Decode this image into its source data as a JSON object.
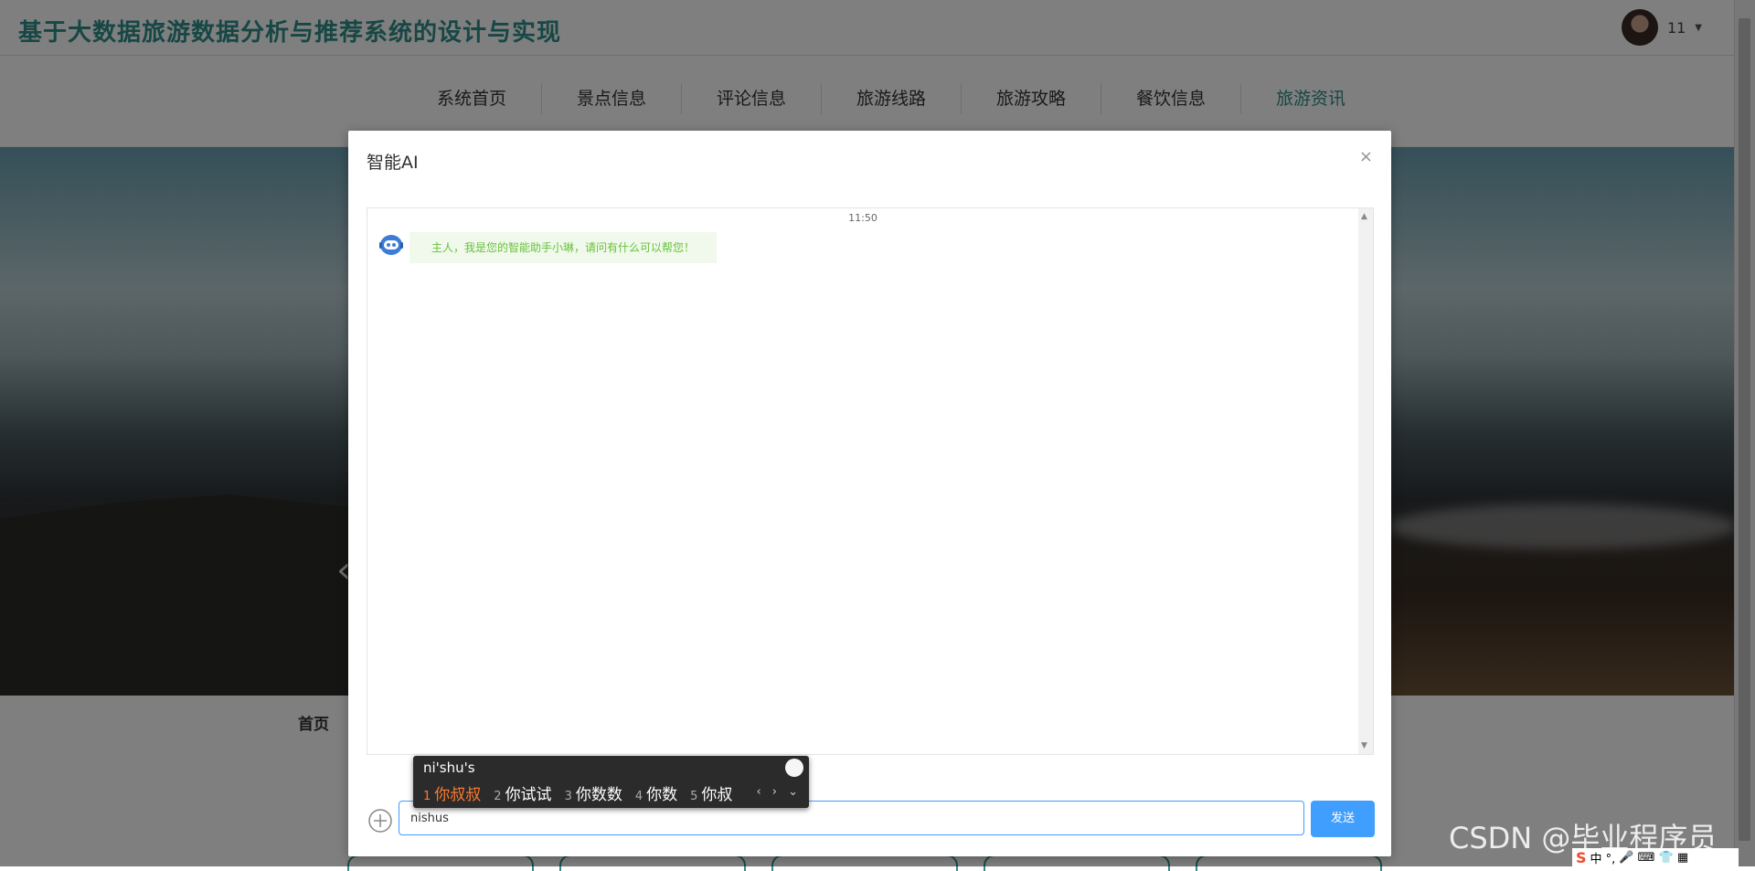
{
  "site": {
    "title": "基于大数据旅游数据分析与推荐系统的设计与实现",
    "user_name": "11"
  },
  "nav": {
    "items": [
      {
        "label": "系统首页"
      },
      {
        "label": "景点信息"
      },
      {
        "label": "评论信息"
      },
      {
        "label": "旅游线路"
      },
      {
        "label": "旅游攻略"
      },
      {
        "label": "餐饮信息"
      },
      {
        "label": "旅游资讯"
      }
    ],
    "active_index": 6
  },
  "breadcrumb": {
    "home": "首页"
  },
  "dialog": {
    "title": "智能AI",
    "close": "×",
    "message_time": "11:50",
    "bot_message": "主人，我是您的智能助手小琳，请问有什么可以帮您！",
    "input_value": "nishus",
    "send_label": "发送"
  },
  "ime": {
    "composition": "ni'shu's",
    "candidates": [
      {
        "num": "1",
        "text": "你叔叔"
      },
      {
        "num": "2",
        "text": "你试试"
      },
      {
        "num": "3",
        "text": "你数数"
      },
      {
        "num": "4",
        "text": "你数"
      },
      {
        "num": "5",
        "text": "你叔"
      }
    ],
    "nav": "‹ › ⌄"
  },
  "watermark": "CSDN @毕业程序员",
  "tray": {
    "s": "S",
    "mode": "中 °,",
    "icons": "🎤 ⌨ 👕 ▦"
  },
  "colors": {
    "accent": "#2f8e8a",
    "primary": "#409eff",
    "bot_text": "#67c23a",
    "bot_bg": "#f0f9eb"
  }
}
